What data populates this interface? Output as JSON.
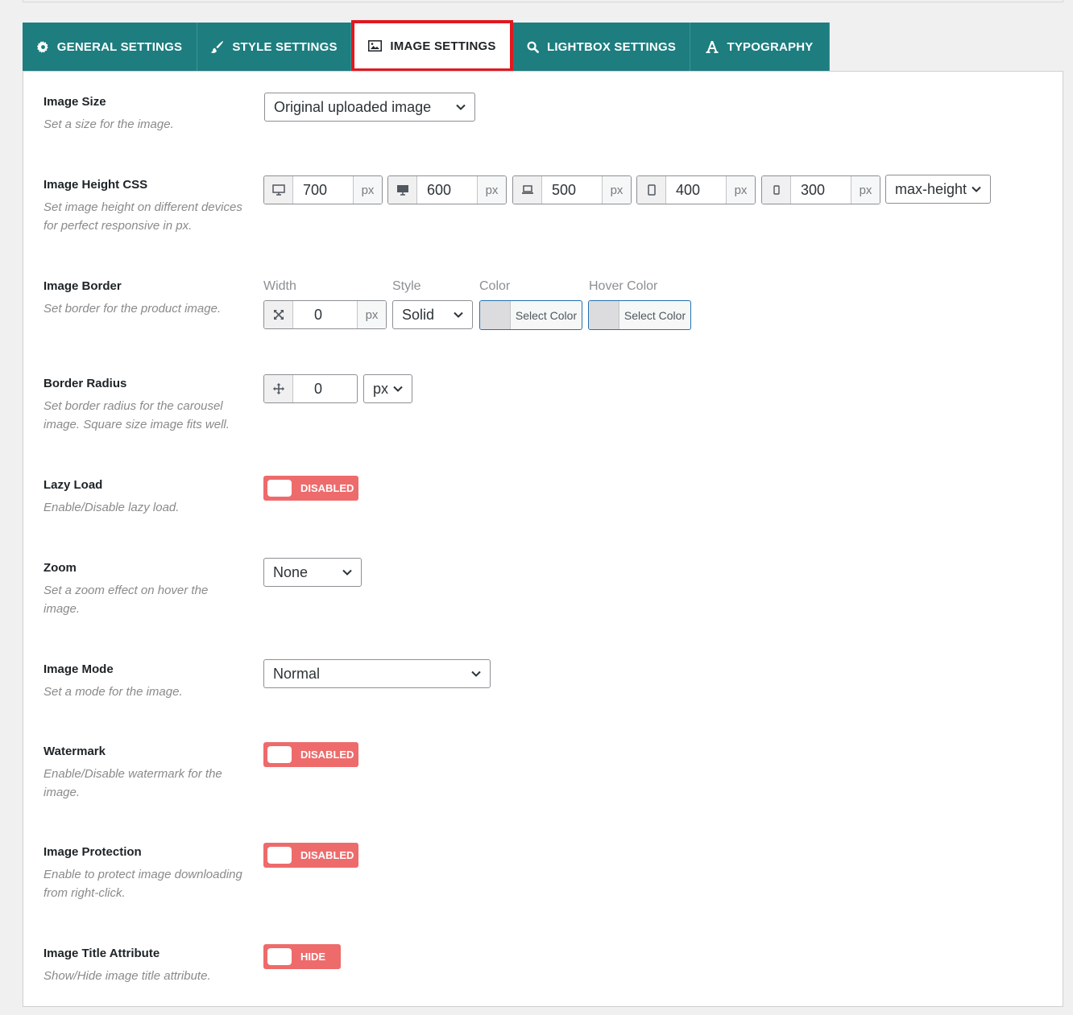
{
  "tabs": [
    {
      "label": "GENERAL SETTINGS",
      "icon": "gear-icon"
    },
    {
      "label": "STYLE SETTINGS",
      "icon": "brush-icon"
    },
    {
      "label": "IMAGE SETTINGS",
      "icon": "image-icon",
      "active": true
    },
    {
      "label": "LIGHTBOX SETTINGS",
      "icon": "search-icon"
    },
    {
      "label": "TYPOGRAPHY",
      "icon": "font-icon"
    }
  ],
  "image_size": {
    "label": "Image Size",
    "desc": "Set a size for the image.",
    "value": "Original uploaded image"
  },
  "image_height": {
    "label": "Image Height CSS",
    "desc": "Set image height on different devices for perfect responsive in px.",
    "fields": [
      {
        "icon": "desktop-icon",
        "value": "700",
        "unit": "px"
      },
      {
        "icon": "monitor-icon",
        "value": "600",
        "unit": "px"
      },
      {
        "icon": "laptop-icon",
        "value": "500",
        "unit": "px"
      },
      {
        "icon": "tablet-icon",
        "value": "400",
        "unit": "px"
      },
      {
        "icon": "mobile-icon",
        "value": "300",
        "unit": "px"
      }
    ],
    "property": "max-height"
  },
  "image_border": {
    "label": "Image Border",
    "desc": "Set border for the product image.",
    "width_label": "Width",
    "width_value": "0",
    "width_unit": "px",
    "style_label": "Style",
    "style_value": "Solid",
    "color_label": "Color",
    "color_button": "Select Color",
    "hover_label": "Hover Color",
    "hover_button": "Select Color"
  },
  "border_radius": {
    "label": "Border Radius",
    "desc": "Set border radius for the carousel image. Square size image fits well.",
    "value": "0",
    "unit": "px"
  },
  "lazy_load": {
    "label": "Lazy Load",
    "desc": "Enable/Disable lazy load.",
    "state": "DISABLED"
  },
  "zoom": {
    "label": "Zoom",
    "desc": "Set a zoom effect on hover the image.",
    "value": "None"
  },
  "image_mode": {
    "label": "Image Mode",
    "desc": "Set a mode for the image.",
    "value": "Normal"
  },
  "watermark": {
    "label": "Watermark",
    "desc": "Enable/Disable watermark for the image.",
    "state": "DISABLED"
  },
  "image_protection": {
    "label": "Image Protection",
    "desc": "Enable to protect image downloading from right-click.",
    "state": "DISABLED"
  },
  "title_attr": {
    "label": "Image Title Attribute",
    "desc": "Show/Hide image title attribute.",
    "state": "HIDE"
  },
  "colors": {
    "tab_bg": "#1d7d7f",
    "active_outline": "#e0191f",
    "toggle_off": "#ee6b6c"
  }
}
